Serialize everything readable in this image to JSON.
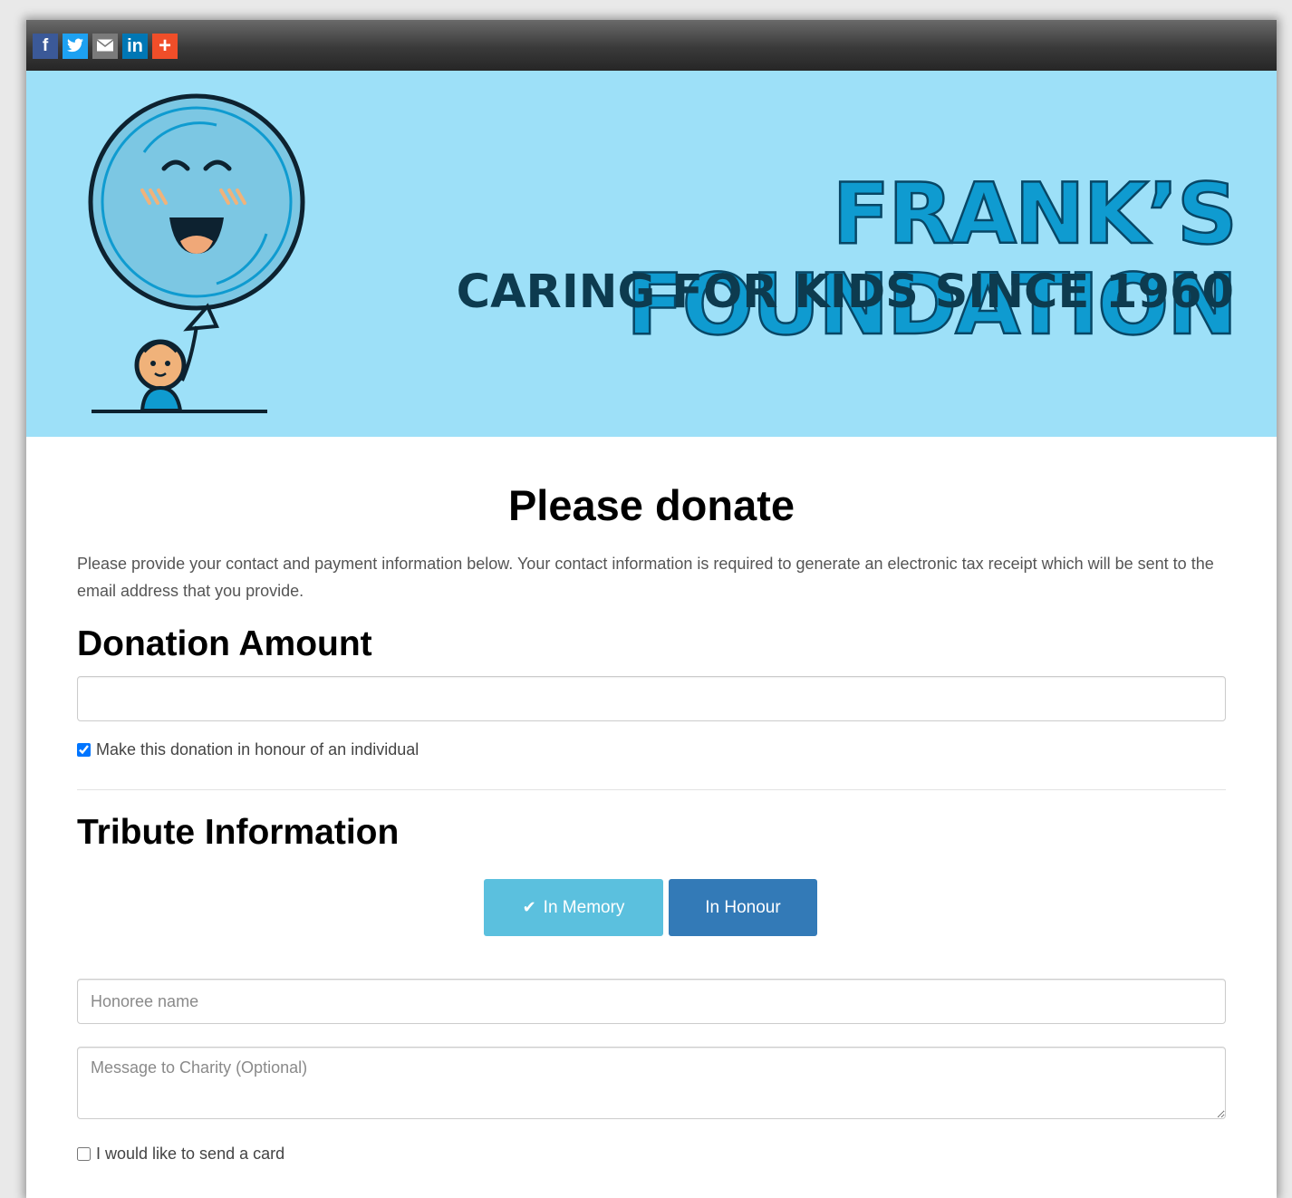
{
  "share_bar": {
    "buttons": [
      {
        "label": "f",
        "icon": "facebook-icon",
        "color": "#3b5998"
      },
      {
        "label": "",
        "icon": "twitter-icon",
        "color": "#1da1f2"
      },
      {
        "label": "",
        "icon": "email-icon",
        "color": "#7a7a7a"
      },
      {
        "label": "in",
        "icon": "linkedin-icon",
        "color": "#0077b5"
      },
      {
        "label": "+",
        "icon": "plus-icon",
        "color": "#f04e29"
      }
    ]
  },
  "banner": {
    "title": "FRANK’S FOUNDATION",
    "tagline": "CARING FOR KIDS SINCE 1960",
    "background": "#9de0f8",
    "title_color": "#0f9bd0"
  },
  "page": {
    "title": "Please donate",
    "intro": "Please provide your contact and payment information below. Your contact information is required to generate an electronic tax receipt which will be sent to the email address that you provide."
  },
  "donation": {
    "heading": "Donation Amount",
    "amount_value": "",
    "honour_checkbox_label": "Make this donation in honour of an individual",
    "honour_checked": true
  },
  "tribute": {
    "heading": "Tribute Information",
    "in_memory_label": "In Memory",
    "in_honour_label": "In Honour",
    "selected": "In Memory",
    "honoree_placeholder": "Honoree name",
    "message_placeholder": "Message to Charity (Optional)",
    "send_card_label": "I would like to send a card",
    "send_card_checked": false
  }
}
